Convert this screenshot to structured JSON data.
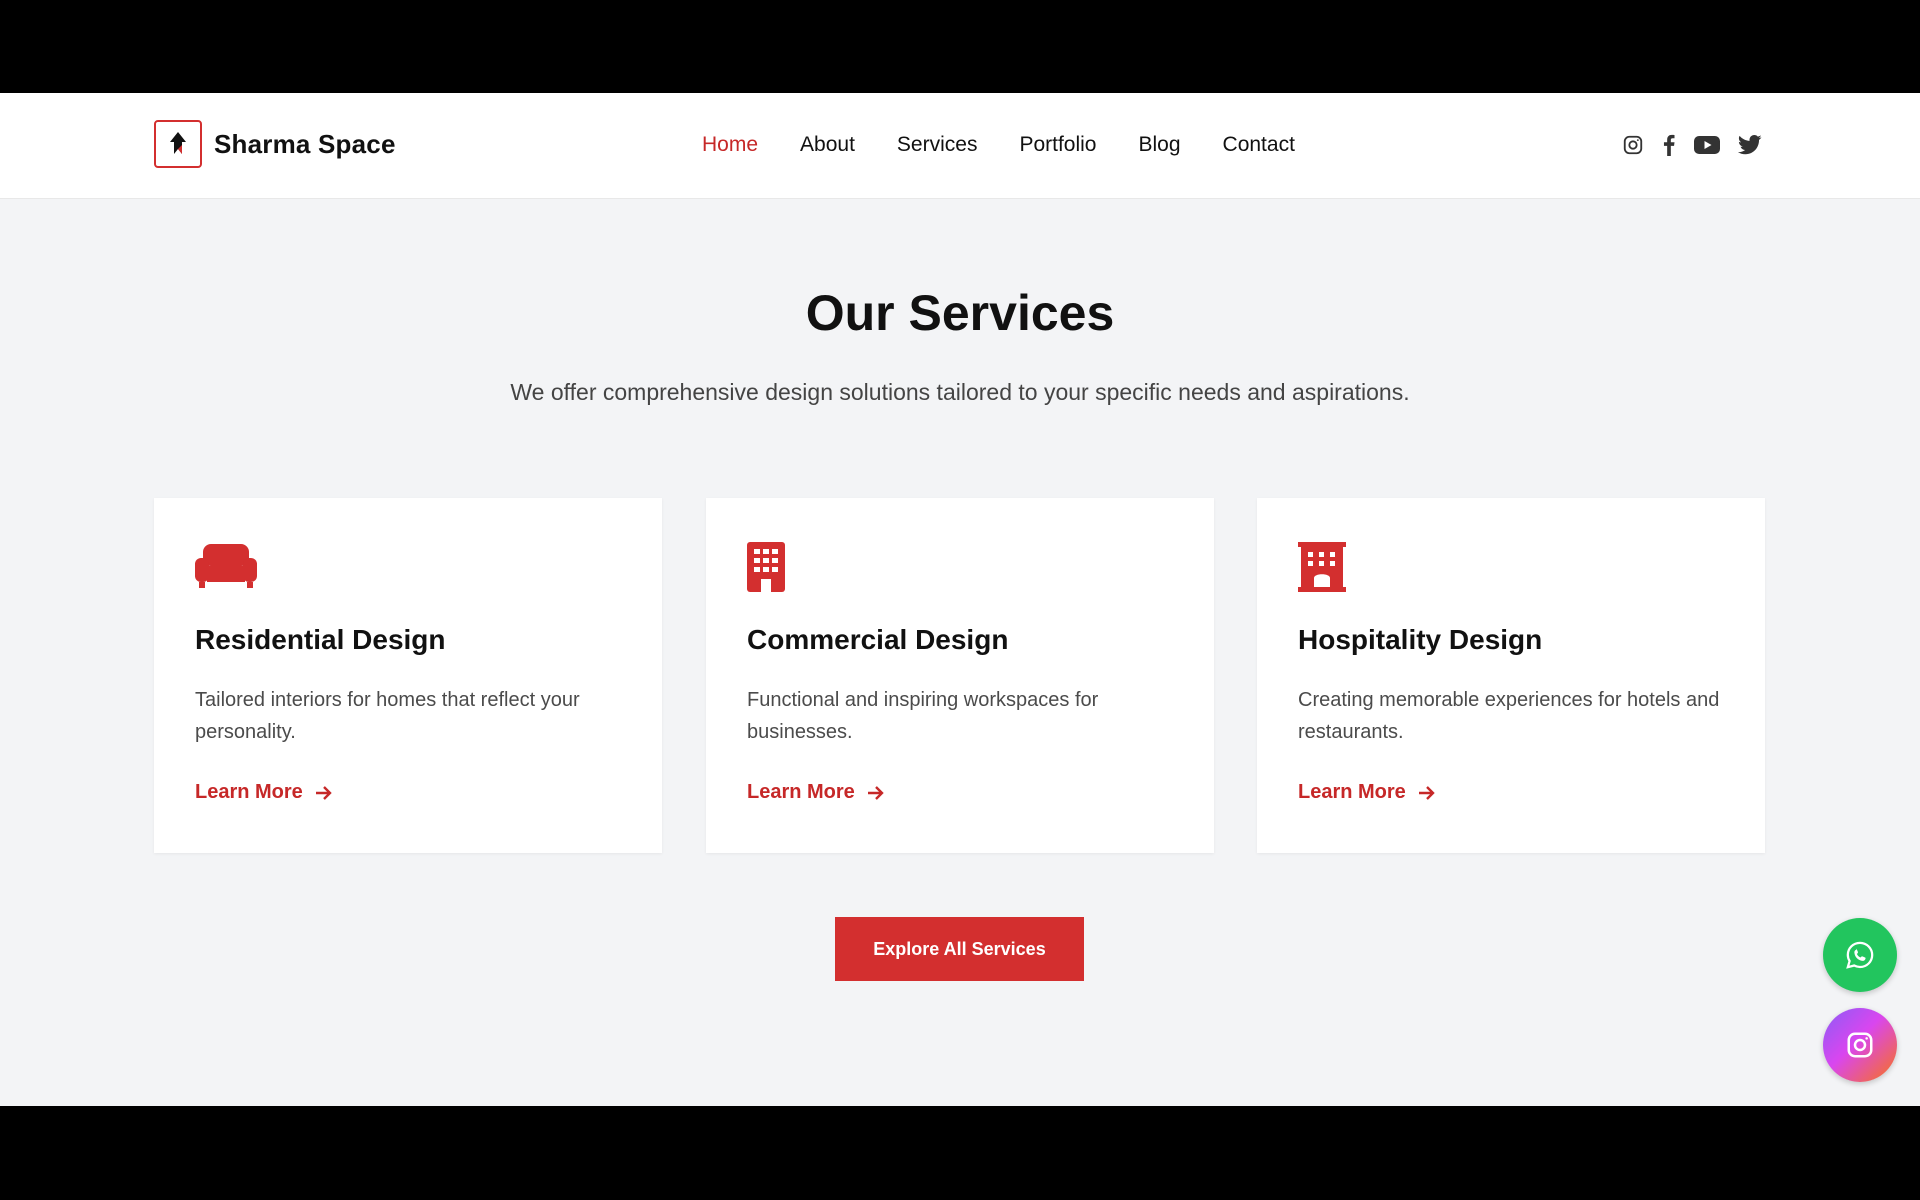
{
  "brand": {
    "name": "Sharma Space",
    "accent_color": "#d32f2f"
  },
  "nav": {
    "items": [
      {
        "label": "Home",
        "active": true
      },
      {
        "label": "About",
        "active": false
      },
      {
        "label": "Services",
        "active": false
      },
      {
        "label": "Portfolio",
        "active": false
      },
      {
        "label": "Blog",
        "active": false
      },
      {
        "label": "Contact",
        "active": false
      }
    ],
    "socials": [
      "instagram-icon",
      "facebook-icon",
      "youtube-icon",
      "twitter-icon"
    ]
  },
  "services": {
    "title": "Our Services",
    "subtitle": "We offer comprehensive design solutions tailored to your specific needs and aspirations.",
    "cards": [
      {
        "icon": "sofa-icon",
        "title": "Residential Design",
        "description": "Tailored interiors for homes that reflect your personality.",
        "link_label": "Learn More"
      },
      {
        "icon": "building-icon",
        "title": "Commercial Design",
        "description": "Functional and inspiring workspaces for businesses.",
        "link_label": "Learn More"
      },
      {
        "icon": "hotel-icon",
        "title": "Hospitality Design",
        "description": "Creating memorable experiences for hotels and restaurants.",
        "link_label": "Learn More"
      }
    ],
    "cta_label": "Explore All Services"
  },
  "floating": {
    "whatsapp": {
      "icon": "whatsapp-icon",
      "color": "#22c55e"
    },
    "instagram": {
      "icon": "instagram-icon"
    }
  }
}
